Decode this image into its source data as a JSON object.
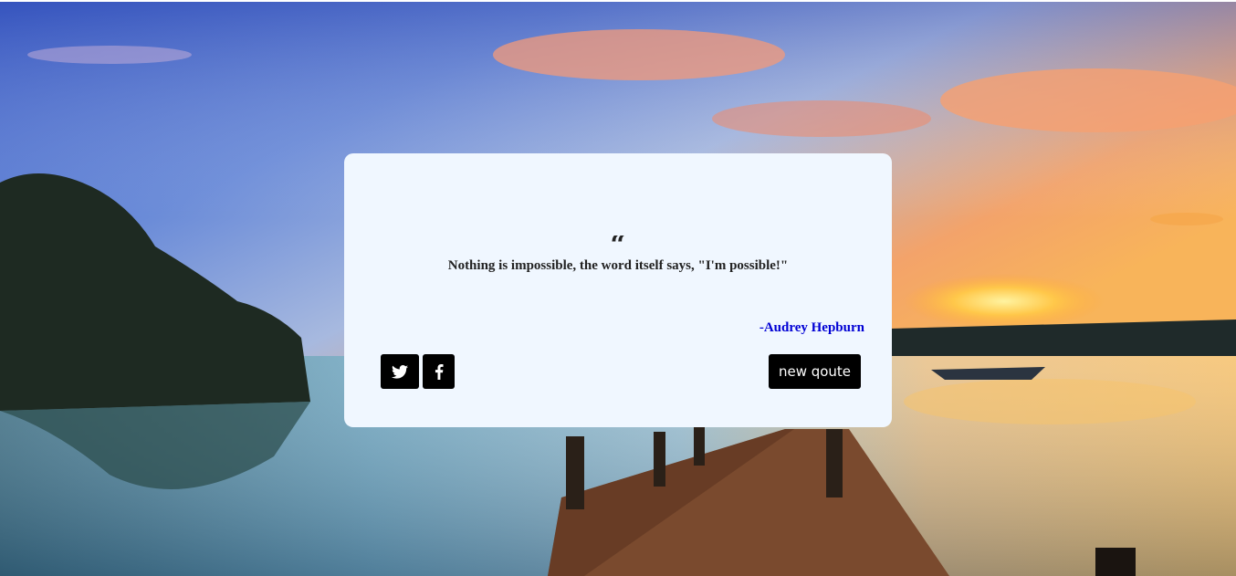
{
  "quote": {
    "icon": "quote-left-icon",
    "text": "Nothing is impossible, the word itself says, \"I'm possible!\"",
    "author": "-Audrey Hepburn"
  },
  "buttons": {
    "twitter_icon": "twitter-icon",
    "facebook_icon": "facebook-icon",
    "new_quote_label": "new qoute"
  },
  "colors": {
    "card_bg": "#f0f7ff",
    "author": "#0000d4",
    "button_bg": "#000000",
    "button_text": "#ffffff"
  }
}
